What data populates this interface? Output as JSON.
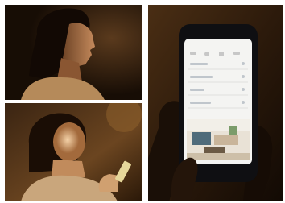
{
  "panels": [
    {
      "name": "woman-profile-dark-photo"
    },
    {
      "name": "woman-looking-at-phone-photo"
    },
    {
      "name": "hand-holding-smartphone-photo"
    }
  ],
  "phone_screen": {
    "rows": 4,
    "has_room_thumbnail": true
  }
}
